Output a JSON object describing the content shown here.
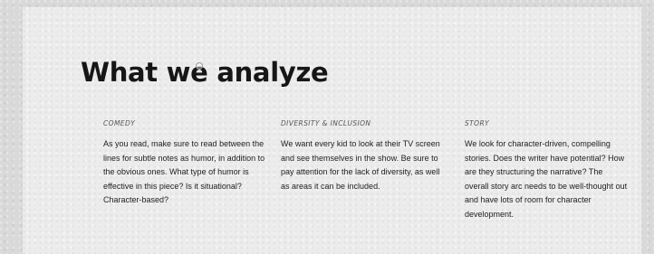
{
  "heading": "What we analyze",
  "columns": [
    {
      "label": "COMEDY",
      "text": "As you read, make sure to read between the lines for subtle notes as humor, in addition to the obvious ones. What type of humor is effective in this piece? Is it situational? Character-based?"
    },
    {
      "label": "DIVERSITY & INCLUSION",
      "text": "We want every kid to look at their TV screen and see themselves in the show. Be sure to pay attention for the lack of diversity, as well as areas it can be included."
    },
    {
      "label": "STORY",
      "text": "We look for character-driven, compelling stories. Does the writer have potential? How are they structuring the narrative? The overall story arc needs to be well-thought out and have lots of room for character development."
    }
  ]
}
